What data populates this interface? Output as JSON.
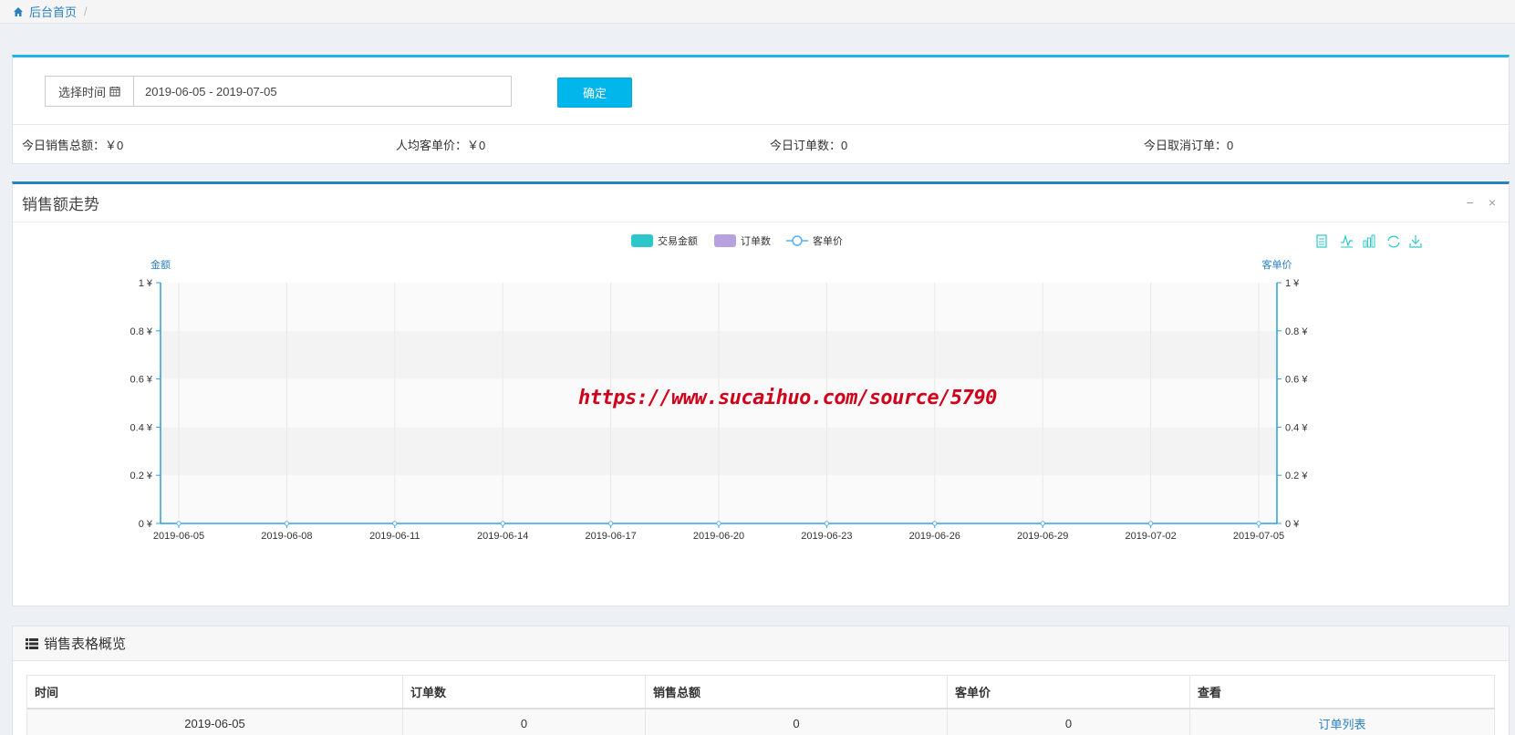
{
  "breadcrumb": {
    "home_label": "后台首页",
    "separator": "/"
  },
  "filter": {
    "date_label": "选择时间",
    "date_value": "2019-06-05 - 2019-07-05",
    "confirm_label": "确定"
  },
  "stats": {
    "today_sales": "今日销售总额：￥0",
    "avg_price": "人均客单价：￥0",
    "today_orders": "今日订单数：0",
    "today_cancelled": "今日取消订单：0"
  },
  "chart_panel": {
    "title": "销售额走势",
    "minimize_icon": "−",
    "close_icon": "×",
    "watermark": "https://www.sucaihuo.com/source/5790"
  },
  "chart_data": {
    "type": "line",
    "legend": [
      "交易金额",
      "订单数",
      "客单价"
    ],
    "legend_colors": [
      "#2ec7c9",
      "#b6a2de",
      "#5ab1ef"
    ],
    "y_left_label": "金额",
    "y_right_label": "客单价",
    "y_ticks": [
      "0 ¥",
      "0.2 ¥",
      "0.4 ¥",
      "0.6 ¥",
      "0.8 ¥",
      "1 ¥"
    ],
    "ylim": [
      0,
      1
    ],
    "x_tick_labels": [
      "2019-06-05",
      "2019-06-08",
      "2019-06-11",
      "2019-06-14",
      "2019-06-17",
      "2019-06-20",
      "2019-06-23",
      "2019-06-26",
      "2019-06-29",
      "2019-07-02",
      "2019-07-05"
    ],
    "series": [
      {
        "name": "客单价",
        "values": [
          0,
          0,
          0,
          0,
          0,
          0,
          0,
          0,
          0,
          0,
          0
        ]
      }
    ],
    "grid": true,
    "legend_position": "top-center",
    "toolbox_icons": [
      "data-view-icon",
      "line-chart-icon",
      "bar-chart-icon",
      "refresh-icon",
      "download-icon"
    ]
  },
  "table_panel": {
    "title": "销售表格概览",
    "columns": [
      "时间",
      "订单数",
      "销售总额",
      "客单价",
      "查看"
    ],
    "rows": [
      {
        "date": "2019-06-05",
        "orders": "0",
        "total": "0",
        "avg": "0",
        "link": "订单列表"
      }
    ]
  }
}
